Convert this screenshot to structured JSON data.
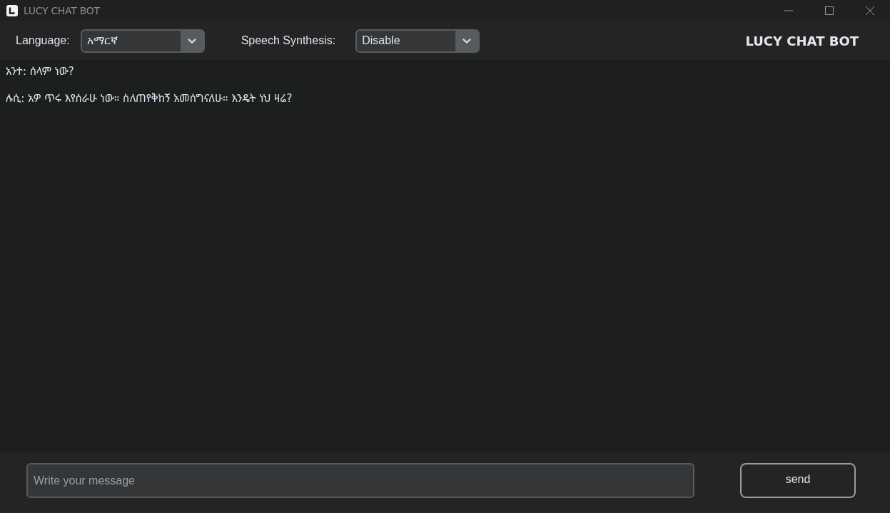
{
  "window": {
    "title": "LUCY CHAT BOT"
  },
  "toolbar": {
    "language": {
      "label": "Language:",
      "value": "አማርኛ"
    },
    "speech_synthesis": {
      "label": "Speech Synthesis:",
      "value": "Disable"
    },
    "app_title": "LUCY CHAT BOT"
  },
  "messages": [
    {
      "text": "አንተ: ሰላም ነው?"
    },
    {
      "text": "ሉሲ: አዎ ጥሩ እየሰራሁ ነው። ስለጠየቅከኝ አመሰግናለሁ። እንዴት ነህ ዛሬ?"
    }
  ],
  "composer": {
    "placeholder": "Write your message",
    "send_button": "send"
  }
}
